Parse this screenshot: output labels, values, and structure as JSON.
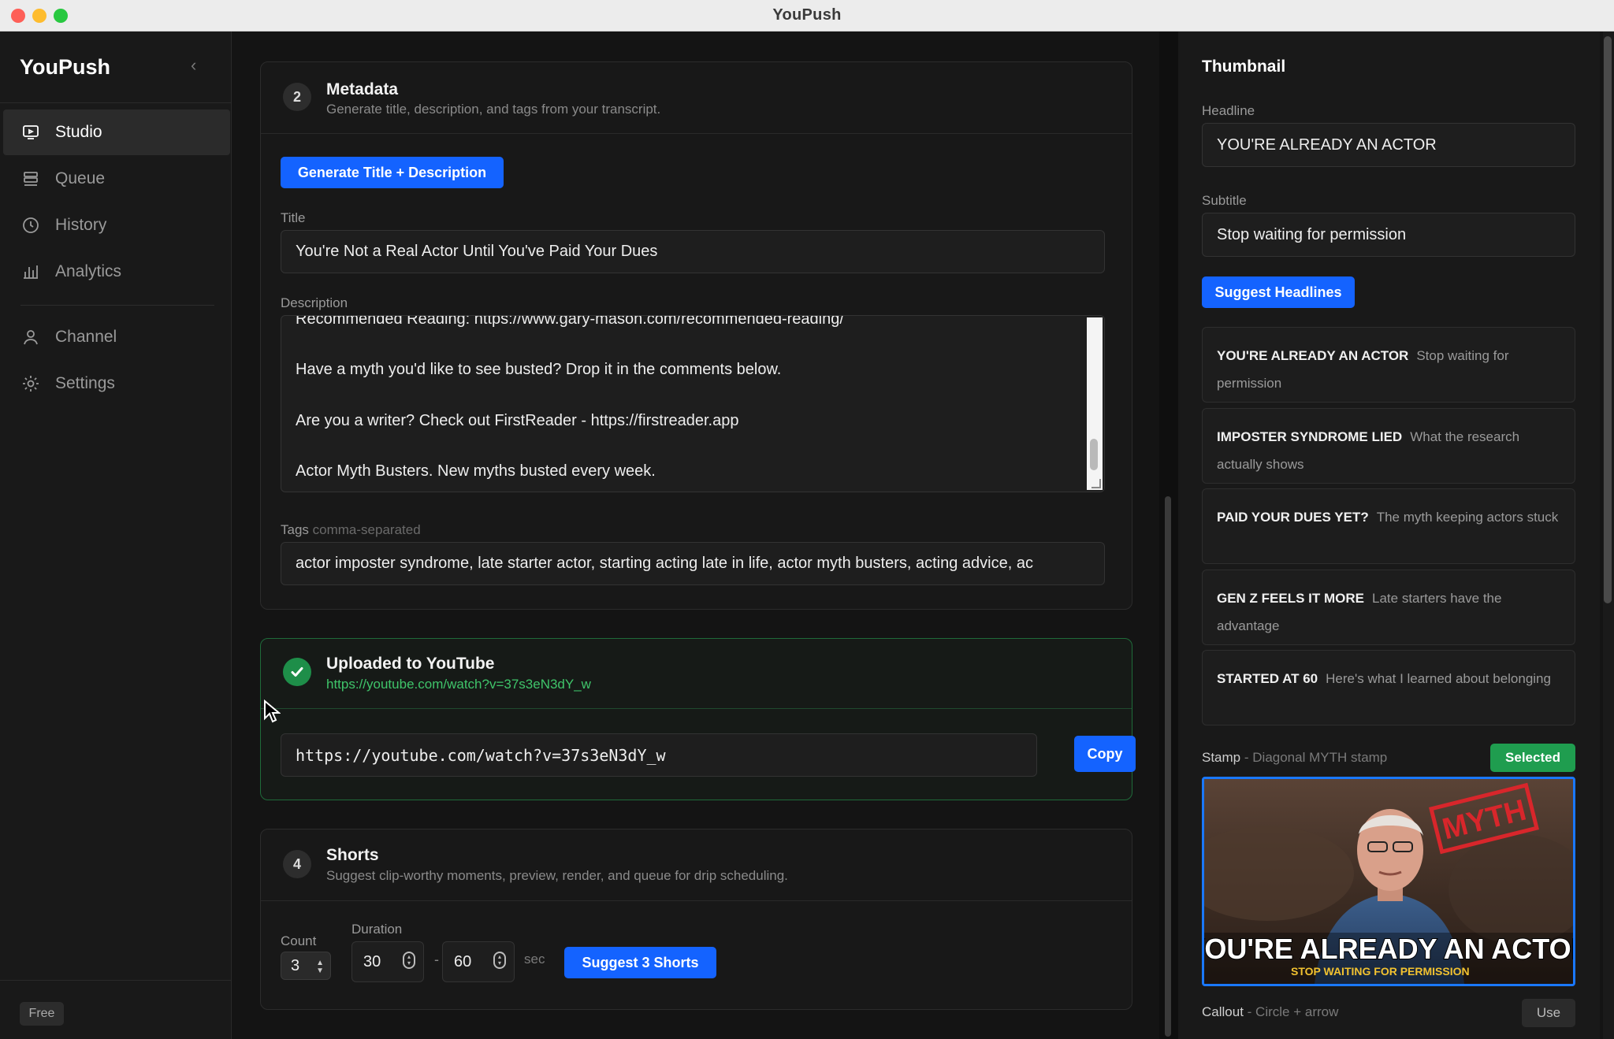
{
  "window": {
    "title": "YouPush"
  },
  "sidebar": {
    "brand": "YouPush",
    "items": [
      {
        "label": "Studio",
        "icon": "tv-icon",
        "active": true
      },
      {
        "label": "Queue",
        "icon": "stack-icon"
      },
      {
        "label": "History",
        "icon": "clock-icon"
      },
      {
        "label": "Analytics",
        "icon": "bar-chart-icon"
      },
      {
        "label": "Channel",
        "icon": "user-icon"
      },
      {
        "label": "Settings",
        "icon": "gear-icon"
      }
    ],
    "plan_badge": "Free"
  },
  "metadata": {
    "step": "2",
    "title": "Metadata",
    "subtitle": "Generate title, description, and tags from your transcript.",
    "generate_button": "Generate Title + Description",
    "title_label": "Title",
    "title_value": "You're Not a Real Actor Until You've Paid Your Dues",
    "description_label": "Description",
    "description_lines": [
      "Recommended Reading: https://www.gary-mason.com/recommended-reading/",
      "Have a myth you'd like to see busted? Drop it in the comments below.",
      "Are you a writer? Check out FirstReader - https://firstreader.app",
      "Actor Myth Busters. New myths busted every week."
    ],
    "tags_label": "Tags",
    "tags_hint": "comma-separated",
    "tags_value": "actor imposter syndrome, late starter actor, starting acting late in life, actor myth busters, acting advice, ac"
  },
  "upload": {
    "title": "Uploaded to YouTube",
    "link": "https://youtube.com/watch?v=37s3eN3dY_w",
    "url_value": "https://youtube.com/watch?v=37s3eN3dY_w",
    "copy_button": "Copy",
    "status_color": "#1e8e49"
  },
  "shorts": {
    "step": "4",
    "title": "Shorts",
    "subtitle": "Suggest clip-worthy moments, preview, render, and queue for drip scheduling.",
    "count_label": "Count",
    "count_value": "3",
    "duration_label": "Duration",
    "duration_min": "30",
    "duration_sep": "-",
    "duration_max": "60",
    "duration_unit": "sec",
    "suggest_button": "Suggest 3 Shorts"
  },
  "thumbnail": {
    "title": "Thumbnail",
    "headline_label": "Headline",
    "headline_value": "YOU'RE ALREADY AN ACTOR",
    "subtitle_label": "Subtitle",
    "subtitle_value": "Stop waiting for permission",
    "suggest_button": "Suggest Headlines",
    "suggestions": [
      {
        "headline": "YOU'RE ALREADY AN ACTOR",
        "subtitle": "Stop waiting for permission"
      },
      {
        "headline": "IMPOSTER SYNDROME LIED",
        "subtitle": "What the research actually shows"
      },
      {
        "headline": "PAID YOUR DUES YET?",
        "subtitle": "The myth keeping actors stuck"
      },
      {
        "headline": "GEN Z FEELS IT MORE",
        "subtitle": "Late starters have the advantage"
      },
      {
        "headline": "STARTED AT 60",
        "subtitle": "Here's what I learned about belonging"
      }
    ],
    "stamp_label": "Stamp",
    "stamp_hint": "- Diagonal MYTH stamp",
    "stamp_selected": "Selected",
    "preview": {
      "stamp_text": "MYTH",
      "headline": "YOU'RE ALREADY AN ACTOR",
      "subtitle": "STOP WAITING FOR PERMISSION"
    },
    "callout_label": "Callout",
    "callout_hint": "- Circle + arrow",
    "use_button": "Use"
  },
  "colors": {
    "accent": "#1463ff",
    "success": "#1f9d4f",
    "stamp_red": "#d8262b"
  }
}
